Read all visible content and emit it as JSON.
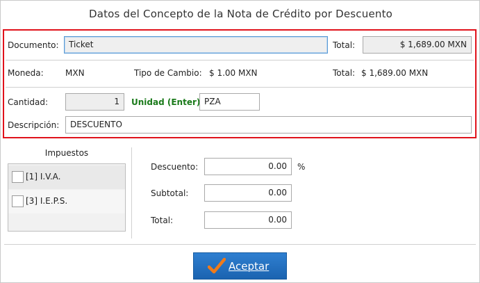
{
  "dialog": {
    "title": "Datos del Concepto de la Nota de Crédito por Descuento"
  },
  "documento": {
    "label": "Documento:",
    "value": "Ticket"
  },
  "total_top": {
    "label": "Total:",
    "value": "$ 1,689.00 MXN"
  },
  "moneda": {
    "label": "Moneda:",
    "value": "MXN"
  },
  "tipo_cambio": {
    "label": "Tipo de Cambio:",
    "value": "$ 1.00 MXN"
  },
  "total_info": {
    "label": "Total:",
    "value": "$ 1,689.00 MXN"
  },
  "cantidad": {
    "label": "Cantidad:",
    "value": "1"
  },
  "unidad": {
    "label": "Unidad (Enter):",
    "value": "PZA"
  },
  "descripcion": {
    "label": "Descripción:",
    "value": "DESCUENTO"
  },
  "impuestos": {
    "title": "Impuestos",
    "items": [
      {
        "label": "[1] I.V.A.",
        "checked": false
      },
      {
        "label": "[3] I.E.P.S.",
        "checked": false
      }
    ]
  },
  "descuento": {
    "label": "Descuento:",
    "value": "0.00",
    "unit": "%"
  },
  "subtotal": {
    "label": "Subtotal:",
    "value": "0.00"
  },
  "total_bottom": {
    "label": "Total:",
    "value": "0.00"
  },
  "aceptar": {
    "label": "Aceptar",
    "icon": "checkmark-icon",
    "color": "#1b63b0",
    "icon_color": "#f07b1a"
  },
  "colors": {
    "highlight": "#e0121b",
    "unidad_label": "#1a7a1a"
  }
}
